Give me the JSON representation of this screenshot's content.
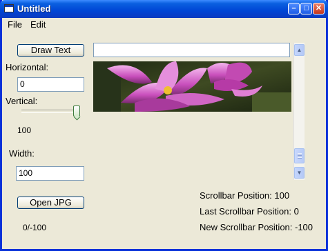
{
  "window": {
    "title": "Untitled"
  },
  "menu": {
    "items": [
      "File",
      "Edit"
    ]
  },
  "controls": {
    "draw_text_button": "Draw Text",
    "horizontal_label": "Horizontal:",
    "horizontal_value": "0",
    "vertical_label": "Vertical:",
    "vertical_slider_value": "100",
    "width_label": "Width:",
    "width_value": "100",
    "open_jpg_button": "Open JPG",
    "position_readout": "0/-100",
    "text_input_value": ""
  },
  "vertical_slider": {
    "level": 0.95
  },
  "scrollbar": {
    "up_icon": "arrow-up",
    "down_icon": "arrow-down",
    "thumb_position": 0.85
  },
  "status": {
    "scrollbar_position": "Scrollbar Position: 100",
    "last_scrollbar_position": "Last Scrollbar Position: 0",
    "new_scrollbar_position": "New Scrollbar Position: -100"
  },
  "colors": {
    "titlebar": "#0a5fe0",
    "window_border": "#0831d9",
    "face": "#ece9d8"
  }
}
